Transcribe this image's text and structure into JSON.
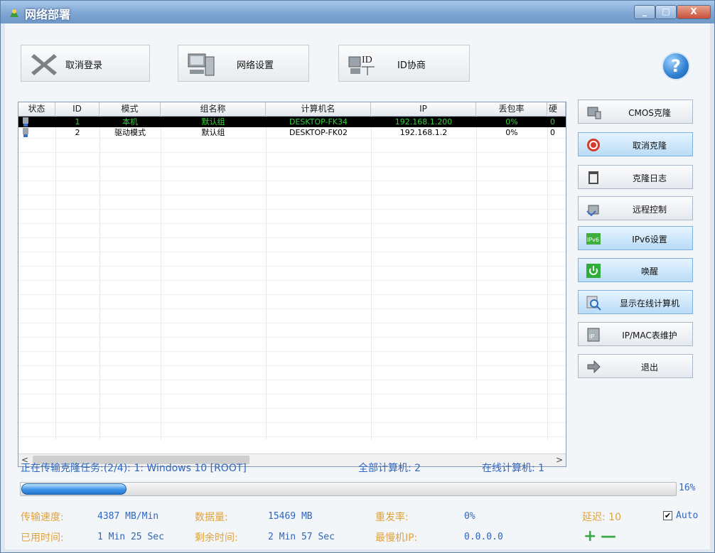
{
  "window": {
    "title": "网络部署",
    "min": "_",
    "max": "□",
    "close": "X"
  },
  "toolbar": [
    {
      "name": "logout-button",
      "icon": "x-icon",
      "label": "取消登录"
    },
    {
      "name": "network-settings-button",
      "icon": "computer-network-icon",
      "label": "网络设置"
    },
    {
      "name": "id-negotiate-button",
      "icon": "id-network-icon",
      "label": "ID协商"
    }
  ],
  "help": "?",
  "table": {
    "headers": [
      "状态",
      "ID",
      "模式",
      "组名称",
      "计算机名",
      "IP",
      "丢包率",
      "硬"
    ],
    "rows": [
      {
        "id": "1",
        "mode": "本机",
        "group": "默认组",
        "computer": "DESKTOP-FK34",
        "ip": "192.168.1.200",
        "loss": "0%",
        "extra": "0",
        "selected": true
      },
      {
        "id": "2",
        "mode": "驱动模式",
        "group": "默认组",
        "computer": "DESKTOP-FK02",
        "ip": "192.168.1.2",
        "loss": "0%",
        "extra": "0",
        "selected": false
      }
    ]
  },
  "side_buttons": [
    {
      "name": "cmos-clone-button",
      "icon": "cmos-icon",
      "label": "CMOS克隆",
      "active": false
    },
    {
      "name": "cancel-clone-button",
      "icon": "cancel-icon",
      "label": "取消克隆",
      "active": true
    },
    {
      "name": "clone-log-button",
      "icon": "log-icon",
      "label": "克隆日志",
      "active": false
    },
    {
      "name": "remote-control-button",
      "icon": "remote-icon",
      "label": "远程控制",
      "active": false
    },
    {
      "name": "ipv6-settings-button",
      "icon": "ipv6-icon",
      "label": "IPv6设置",
      "active": true
    },
    {
      "name": "wake-button",
      "icon": "power-icon",
      "label": "唤醒",
      "active": true
    },
    {
      "name": "show-online-button",
      "icon": "search-icon",
      "label": "显示在线计算机",
      "active": true
    },
    {
      "name": "ip-mac-table-button",
      "icon": "ip-table-icon",
      "label": "IP/MAC表维护",
      "active": false
    },
    {
      "name": "exit-button",
      "icon": "exit-icon",
      "label": "退出",
      "active": false
    }
  ],
  "status": {
    "task": "正在传输克隆任务:(2/4): 1: Windows 10 [ROOT]",
    "all_label": "全部计算机: 2",
    "online_label": "在线计算机: 1"
  },
  "progress": {
    "fraction": 0.16,
    "text": "16%"
  },
  "stats": {
    "speed_label": "传输速度:",
    "speed": "4387 MB/Min",
    "data_label": "数据量:",
    "data": "15469 MB",
    "resend_label": "重发率:",
    "resend": "0%",
    "delay_label": "延迟: 10",
    "auto_checked": "✔",
    "auto": "Auto",
    "used_label": "已用时间:",
    "used": "1 Min 25 Sec",
    "remain_label": "剩余时间:",
    "remain": "2 Min 57 Sec",
    "slowest_label": "最慢机IP:",
    "slowest": "0.0.0.0",
    "plus": "+",
    "minus": "—"
  },
  "colors": {
    "accent": "#2e66c2",
    "label_orange": "#e0a23a",
    "selected_text": "#34d23a"
  }
}
